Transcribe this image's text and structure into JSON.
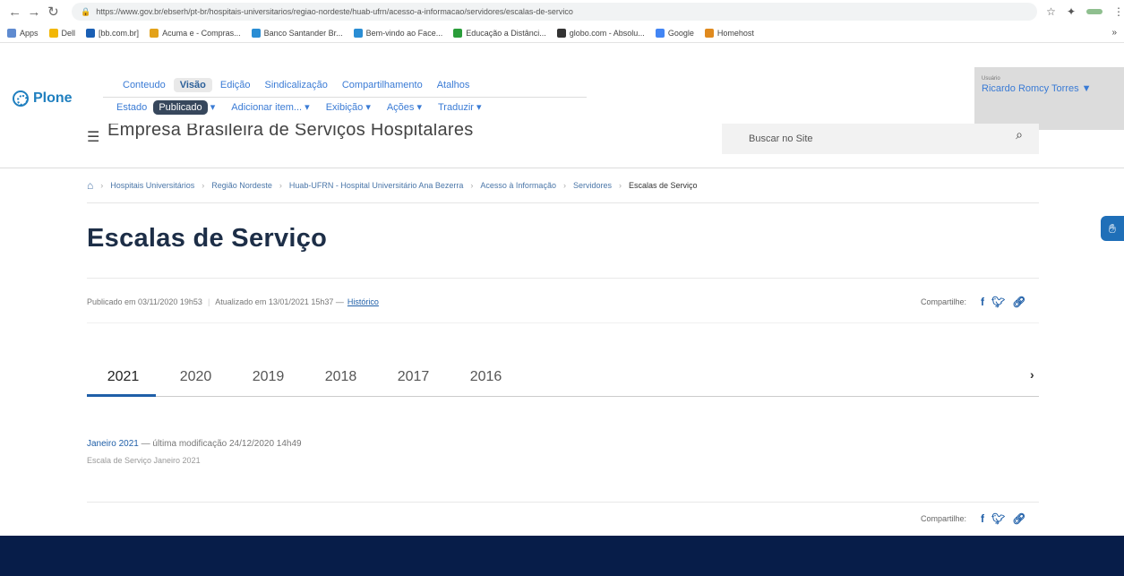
{
  "browser": {
    "url": "https://www.gov.br/ebserh/pt-br/hospitais-universitarios/regiao-nordeste/huab-ufrn/acesso-a-informacao/servidores/escalas-de-servico",
    "bookmarks": [
      {
        "label": "Apps",
        "color": "#5f8bd0"
      },
      {
        "label": "Dell",
        "color": "#f2b705"
      },
      {
        "label": "[bb.com.br]",
        "color": "#1a5fb4"
      },
      {
        "label": "Acuma e - Compras...",
        "color": "#e3a21a"
      },
      {
        "label": "Banco Santander Br...",
        "color": "#2a8dd4"
      },
      {
        "label": "Bem-vindo ao Face...",
        "color": "#2a8dd4"
      },
      {
        "label": "Educação a Distânci...",
        "color": "#2a9d3a"
      },
      {
        "label": "globo.com - Absolu...",
        "color": "#333333"
      },
      {
        "label": "Google",
        "color": "#4285f4"
      },
      {
        "label": "Homehost",
        "color": "#e08a1e"
      }
    ]
  },
  "plone": {
    "logo": "Plone",
    "tabs": [
      "Conteudo",
      "Visão",
      "Edição",
      "Sindicalização",
      "Compartilhamento",
      "Atalhos"
    ],
    "state_label": "Estado",
    "state_value": "Publicado",
    "menus": [
      "Adicionar item... ▾",
      "Exibição ▾",
      "Ações ▾",
      "Traduzir ▾"
    ],
    "user_caption": "Usuário",
    "user_name": "Ricardo Romcy Torres ▼"
  },
  "site": {
    "name": "Empresa Brasileira de Serviços Hospitalares",
    "search_placeholder": "Buscar no Site"
  },
  "breadcrumb": [
    "Hospitais Universitários",
    "Região Nordeste",
    "Huab-UFRN - Hospital Universitário Ana Bezerra",
    "Acesso à Informação",
    "Servidores",
    "Escalas de Serviço"
  ],
  "page": {
    "title": "Escalas de Serviço",
    "published": "Publicado em 03/11/2020 19h53",
    "updated": "Atualizado em 13/01/2021 15h37 —",
    "history": "Histórico",
    "share_label": "Compartilhe:"
  },
  "tabs": {
    "years": [
      "2021",
      "2020",
      "2019",
      "2018",
      "2017",
      "2016"
    ],
    "active": "2021",
    "next": "›"
  },
  "item": {
    "title": "Janeiro 2021",
    "modified": " — última modificação 24/12/2020 14h49",
    "description": "Escala de Serviço Janeiro 2021"
  },
  "colors": {
    "accent": "#1f5fa8",
    "footer": "#071d49",
    "title": "#1d2e47"
  }
}
